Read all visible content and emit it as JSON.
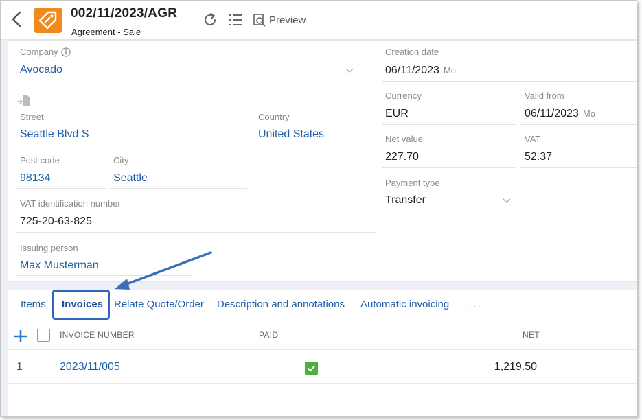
{
  "header": {
    "title": "002/11/2023/AGR",
    "subtitle": "Agreement - Sale",
    "preview_label": "Preview"
  },
  "form": {
    "company": {
      "label": "Company",
      "value": "Avocado"
    },
    "street": {
      "label": "Street",
      "value": "Seattle Blvd S"
    },
    "country": {
      "label": "Country",
      "value": "United States"
    },
    "post_code": {
      "label": "Post code",
      "value": "98134"
    },
    "city": {
      "label": "City",
      "value": "Seattle"
    },
    "vat_id": {
      "label": "VAT identification number",
      "value": "725-20-63-825"
    },
    "issuing_person": {
      "label": "Issuing person",
      "value": "Max Musterman"
    },
    "creation_date": {
      "label": "Creation date",
      "value": "06/11/2023",
      "day": "Mo"
    },
    "currency": {
      "label": "Currency",
      "value": "EUR"
    },
    "valid_from": {
      "label": "Valid from",
      "value": "06/11/2023",
      "day": "Mo"
    },
    "net_value": {
      "label": "Net value",
      "value": "227.70"
    },
    "vat": {
      "label": "VAT",
      "value": "52.37"
    },
    "payment_type": {
      "label": "Payment type",
      "value": "Transfer"
    }
  },
  "tabs": [
    "Items",
    "Invoices",
    "Relate Quote/Order",
    "Description and annotations",
    "Automatic invoicing"
  ],
  "more_label": "···",
  "grid": {
    "columns": {
      "invoice_number": "INVOICE NUMBER",
      "paid": "PAID",
      "net": "NET"
    },
    "rows": [
      {
        "index": "1",
        "invoice_number": "2023/11/005",
        "paid": true,
        "net": "1,219.50"
      }
    ]
  },
  "colors": {
    "accent": "#1f5fa8",
    "logo": "#f08a1c",
    "highlight": "#3065c0",
    "paid_check": "#4caf3f"
  }
}
